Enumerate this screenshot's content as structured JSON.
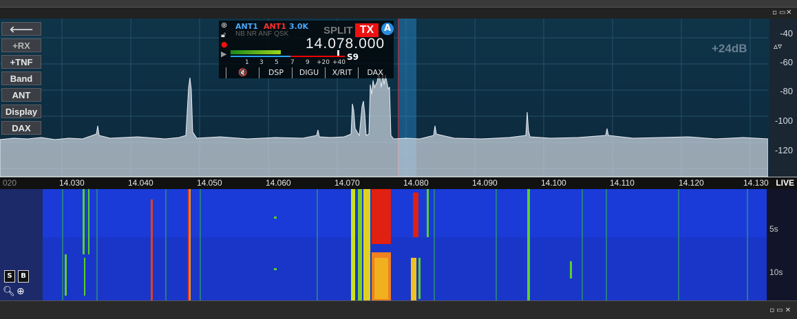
{
  "window": {
    "controls": [
      "▫",
      "▭",
      "✕"
    ]
  },
  "left_buttons": [
    {
      "label": "🡐",
      "dim": false
    },
    {
      "label": "+RX",
      "dim": true
    },
    {
      "label": "+TNF",
      "dim": false
    },
    {
      "label": "Band",
      "dim": false
    },
    {
      "label": "ANT",
      "dim": false
    },
    {
      "label": "Display",
      "dim": false
    },
    {
      "label": "DAX",
      "dim": false
    }
  ],
  "panadapter": {
    "gain": "+24dB",
    "db_labels": [
      "-40",
      "-60",
      "-80",
      "-100",
      "-120"
    ]
  },
  "slice": {
    "rx_ant": "ANT1",
    "tx_ant": "ANT1",
    "filter_bw": "3.0K",
    "flags": "NB NR ANF QSK",
    "split_label": "SPLIT",
    "tx_label": "TX",
    "slice_letter": "A",
    "frequency": "14.078.000",
    "s_reading": "S9",
    "meter_scale": [
      "1",
      "3",
      "5",
      "7",
      "9",
      "+20",
      "+40"
    ],
    "buttons": [
      "🔇",
      "DSP",
      "DIGU",
      "X/RIT",
      "DAX"
    ]
  },
  "frequency_scale": {
    "left_partial": "020",
    "labels": [
      "14.030",
      "14.040",
      "14.050",
      "14.060",
      "14.070",
      "14.080",
      "14.090",
      "14.100",
      "14.110",
      "14.120",
      "14.130"
    ],
    "live": "LIVE"
  },
  "waterfall": {
    "time_labels": [
      "5s",
      "10s"
    ],
    "buttons": [
      "S",
      "B"
    ]
  },
  "colors": {
    "tx_red": "#e11111",
    "slice_blue": "#2b8de0",
    "waterfall_bg": "#1a3bd8"
  }
}
